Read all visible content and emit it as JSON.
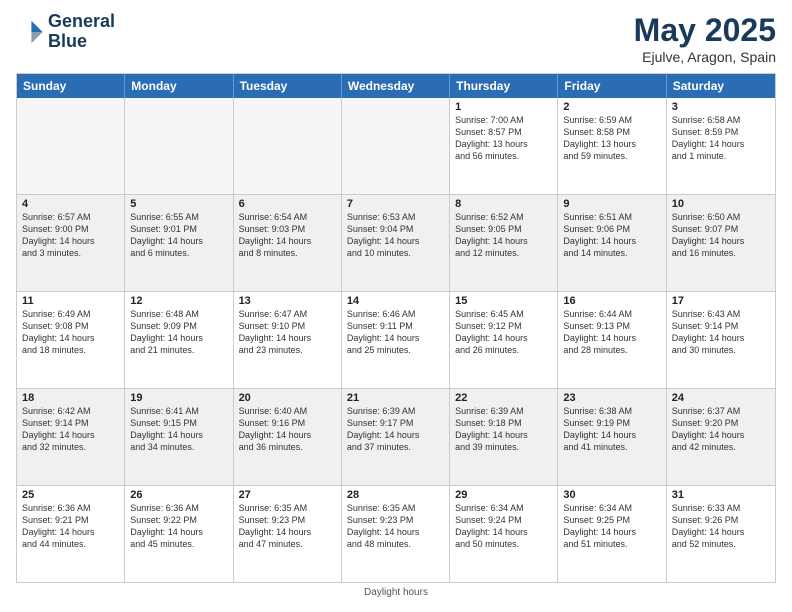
{
  "header": {
    "logo_line1": "General",
    "logo_line2": "Blue",
    "title": "May 2025",
    "subtitle": "Ejulve, Aragon, Spain"
  },
  "days_of_week": [
    "Sunday",
    "Monday",
    "Tuesday",
    "Wednesday",
    "Thursday",
    "Friday",
    "Saturday"
  ],
  "footer": "Daylight hours",
  "weeks": [
    [
      {
        "day": "",
        "text": "",
        "empty": true
      },
      {
        "day": "",
        "text": "",
        "empty": true
      },
      {
        "day": "",
        "text": "",
        "empty": true
      },
      {
        "day": "",
        "text": "",
        "empty": true
      },
      {
        "day": "1",
        "text": "Sunrise: 7:00 AM\nSunset: 8:57 PM\nDaylight: 13 hours\nand 56 minutes.",
        "empty": false
      },
      {
        "day": "2",
        "text": "Sunrise: 6:59 AM\nSunset: 8:58 PM\nDaylight: 13 hours\nand 59 minutes.",
        "empty": false
      },
      {
        "day": "3",
        "text": "Sunrise: 6:58 AM\nSunset: 8:59 PM\nDaylight: 14 hours\nand 1 minute.",
        "empty": false
      }
    ],
    [
      {
        "day": "4",
        "text": "Sunrise: 6:57 AM\nSunset: 9:00 PM\nDaylight: 14 hours\nand 3 minutes.",
        "empty": false
      },
      {
        "day": "5",
        "text": "Sunrise: 6:55 AM\nSunset: 9:01 PM\nDaylight: 14 hours\nand 6 minutes.",
        "empty": false
      },
      {
        "day": "6",
        "text": "Sunrise: 6:54 AM\nSunset: 9:03 PM\nDaylight: 14 hours\nand 8 minutes.",
        "empty": false
      },
      {
        "day": "7",
        "text": "Sunrise: 6:53 AM\nSunset: 9:04 PM\nDaylight: 14 hours\nand 10 minutes.",
        "empty": false
      },
      {
        "day": "8",
        "text": "Sunrise: 6:52 AM\nSunset: 9:05 PM\nDaylight: 14 hours\nand 12 minutes.",
        "empty": false
      },
      {
        "day": "9",
        "text": "Sunrise: 6:51 AM\nSunset: 9:06 PM\nDaylight: 14 hours\nand 14 minutes.",
        "empty": false
      },
      {
        "day": "10",
        "text": "Sunrise: 6:50 AM\nSunset: 9:07 PM\nDaylight: 14 hours\nand 16 minutes.",
        "empty": false
      }
    ],
    [
      {
        "day": "11",
        "text": "Sunrise: 6:49 AM\nSunset: 9:08 PM\nDaylight: 14 hours\nand 18 minutes.",
        "empty": false
      },
      {
        "day": "12",
        "text": "Sunrise: 6:48 AM\nSunset: 9:09 PM\nDaylight: 14 hours\nand 21 minutes.",
        "empty": false
      },
      {
        "day": "13",
        "text": "Sunrise: 6:47 AM\nSunset: 9:10 PM\nDaylight: 14 hours\nand 23 minutes.",
        "empty": false
      },
      {
        "day": "14",
        "text": "Sunrise: 6:46 AM\nSunset: 9:11 PM\nDaylight: 14 hours\nand 25 minutes.",
        "empty": false
      },
      {
        "day": "15",
        "text": "Sunrise: 6:45 AM\nSunset: 9:12 PM\nDaylight: 14 hours\nand 26 minutes.",
        "empty": false
      },
      {
        "day": "16",
        "text": "Sunrise: 6:44 AM\nSunset: 9:13 PM\nDaylight: 14 hours\nand 28 minutes.",
        "empty": false
      },
      {
        "day": "17",
        "text": "Sunrise: 6:43 AM\nSunset: 9:14 PM\nDaylight: 14 hours\nand 30 minutes.",
        "empty": false
      }
    ],
    [
      {
        "day": "18",
        "text": "Sunrise: 6:42 AM\nSunset: 9:14 PM\nDaylight: 14 hours\nand 32 minutes.",
        "empty": false
      },
      {
        "day": "19",
        "text": "Sunrise: 6:41 AM\nSunset: 9:15 PM\nDaylight: 14 hours\nand 34 minutes.",
        "empty": false
      },
      {
        "day": "20",
        "text": "Sunrise: 6:40 AM\nSunset: 9:16 PM\nDaylight: 14 hours\nand 36 minutes.",
        "empty": false
      },
      {
        "day": "21",
        "text": "Sunrise: 6:39 AM\nSunset: 9:17 PM\nDaylight: 14 hours\nand 37 minutes.",
        "empty": false
      },
      {
        "day": "22",
        "text": "Sunrise: 6:39 AM\nSunset: 9:18 PM\nDaylight: 14 hours\nand 39 minutes.",
        "empty": false
      },
      {
        "day": "23",
        "text": "Sunrise: 6:38 AM\nSunset: 9:19 PM\nDaylight: 14 hours\nand 41 minutes.",
        "empty": false
      },
      {
        "day": "24",
        "text": "Sunrise: 6:37 AM\nSunset: 9:20 PM\nDaylight: 14 hours\nand 42 minutes.",
        "empty": false
      }
    ],
    [
      {
        "day": "25",
        "text": "Sunrise: 6:36 AM\nSunset: 9:21 PM\nDaylight: 14 hours\nand 44 minutes.",
        "empty": false
      },
      {
        "day": "26",
        "text": "Sunrise: 6:36 AM\nSunset: 9:22 PM\nDaylight: 14 hours\nand 45 minutes.",
        "empty": false
      },
      {
        "day": "27",
        "text": "Sunrise: 6:35 AM\nSunset: 9:23 PM\nDaylight: 14 hours\nand 47 minutes.",
        "empty": false
      },
      {
        "day": "28",
        "text": "Sunrise: 6:35 AM\nSunset: 9:23 PM\nDaylight: 14 hours\nand 48 minutes.",
        "empty": false
      },
      {
        "day": "29",
        "text": "Sunrise: 6:34 AM\nSunset: 9:24 PM\nDaylight: 14 hours\nand 50 minutes.",
        "empty": false
      },
      {
        "day": "30",
        "text": "Sunrise: 6:34 AM\nSunset: 9:25 PM\nDaylight: 14 hours\nand 51 minutes.",
        "empty": false
      },
      {
        "day": "31",
        "text": "Sunrise: 6:33 AM\nSunset: 9:26 PM\nDaylight: 14 hours\nand 52 minutes.",
        "empty": false
      }
    ]
  ]
}
